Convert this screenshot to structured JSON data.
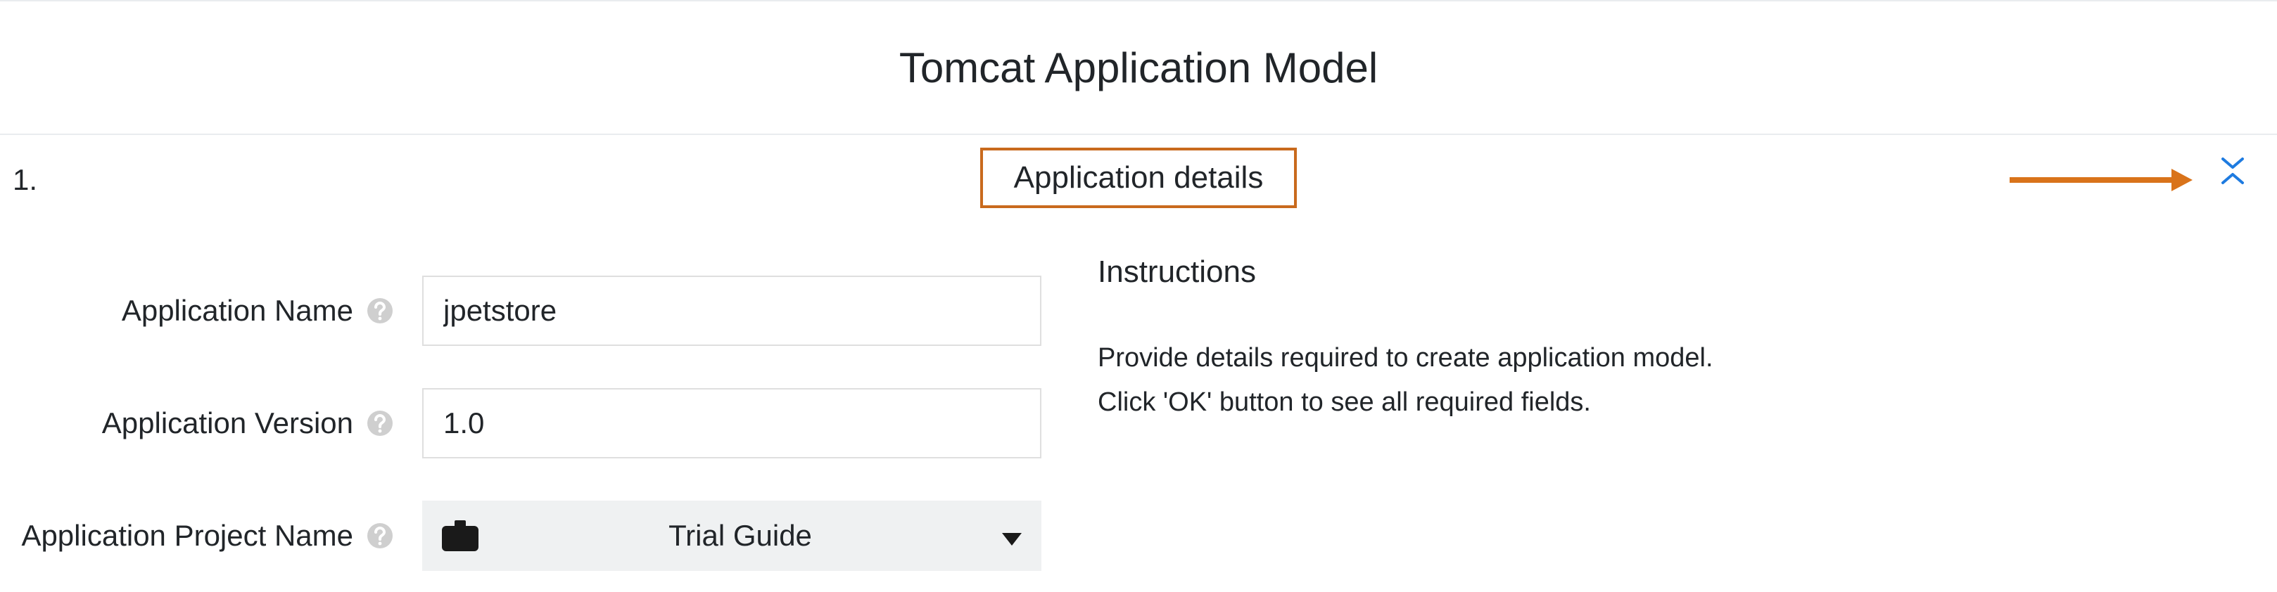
{
  "page": {
    "title": "Tomcat Application Model"
  },
  "section": {
    "step_number": "1.",
    "heading": "Application details"
  },
  "fields": {
    "app_name": {
      "label": "Application Name",
      "value": "jpetstore"
    },
    "app_version": {
      "label": "Application Version",
      "value": "1.0"
    },
    "project": {
      "label": "Application Project Name",
      "selected": "Trial Guide"
    }
  },
  "instructions": {
    "title": "Instructions",
    "line1": "Provide details required to create application model.",
    "line2": "Click 'OK' button to see all required fields."
  }
}
